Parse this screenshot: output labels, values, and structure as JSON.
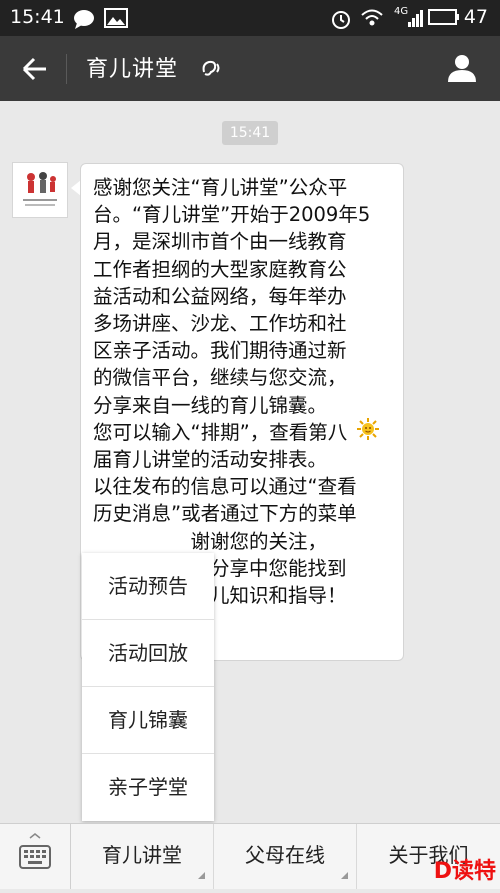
{
  "statusbar": {
    "time": "15:41",
    "network": "4G",
    "battery": "47"
  },
  "header": {
    "title": "育儿讲堂"
  },
  "chat": {
    "timestamp": "15:41",
    "message": "感谢您关注“育儿讲堂”公众平\n台。“育儿讲堂”开始于2009年5\n月，是深圳市首个由一线教育\n工作者担纲的大型家庭教育公\n益活动和公益网络，每年举办\n多场讲座、沙龙、工作坊和社\n区亲子活动。我们期待通过新\n的微信平台，继续与您交流，\n分享来自一线的育儿锦囊。\n您可以输入“排期”，查看第八\n届育儿讲堂的活动安排表。\n以往发布的信息可以通过“查看\n历史消息”或者通过下方的菜单\n　　　　　谢谢您的关注，\n　　　　　和分享中您能找到\n　　　　　育儿知识和指导！"
  },
  "popup": {
    "items": [
      "活动预告",
      "活动回放",
      "育儿锦囊",
      "亲子学堂"
    ]
  },
  "bottom_menu": {
    "items": [
      "育儿讲堂",
      "父母在线",
      "关于我们"
    ]
  },
  "watermark": "D读特"
}
